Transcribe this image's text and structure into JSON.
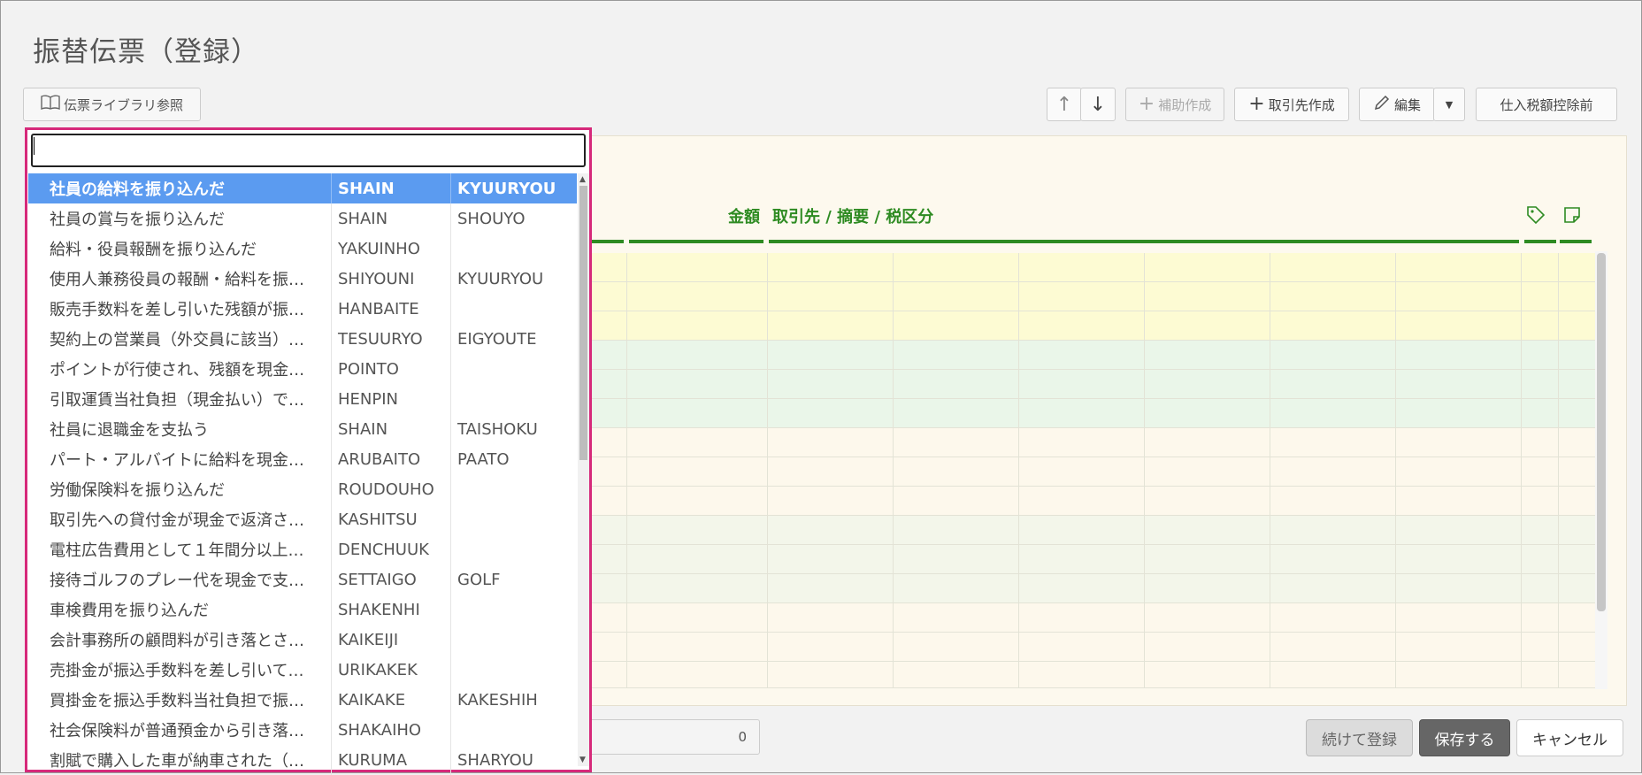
{
  "page": {
    "title": "振替伝票（登録）"
  },
  "toolbar": {
    "library_label": "伝票ライブラリ参照",
    "up_label": "↑",
    "down_label": "↓",
    "sub_create_label": "補助作成",
    "partner_create_label": "取引先作成",
    "edit_label": "編集",
    "tax_label": "仕入税額控除前"
  },
  "grid": {
    "amount_header": "金額",
    "partner_header": "取引先 / 摘要 / 税区分"
  },
  "footer": {
    "total_value": "0",
    "continue_label": "続けて登録",
    "save_label": "保存する",
    "cancel_label": "キャンセル"
  },
  "dropdown": {
    "search_value": "",
    "items": [
      {
        "name": "社員の給料を振り込んだ",
        "code1": "SHAIN",
        "code2": "KYUURYOU"
      },
      {
        "name": "社員の賞与を振り込んだ",
        "code1": "SHAIN",
        "code2": "SHOUYO"
      },
      {
        "name": "給料・役員報酬を振り込んだ",
        "code1": "YAKUINHO",
        "code2": ""
      },
      {
        "name": "使用人兼務役員の報酬・給料を振…",
        "code1": "SHIYOUNI",
        "code2": "KYUURYOU"
      },
      {
        "name": "販売手数料を差し引いた残額が振…",
        "code1": "HANBAITE",
        "code2": ""
      },
      {
        "name": "契約上の営業員（外交員に該当）…",
        "code1": "TESUURYO",
        "code2": "EIGYOUTE"
      },
      {
        "name": "ポイントが行使され、残額を現金…",
        "code1": "POINTO",
        "code2": ""
      },
      {
        "name": "引取運賃当社負担（現金払い）で…",
        "code1": "HENPIN",
        "code2": ""
      },
      {
        "name": "社員に退職金を支払う",
        "code1": "SHAIN",
        "code2": "TAISHOKU"
      },
      {
        "name": "パート・アルバイトに給料を現金…",
        "code1": "ARUBAITO",
        "code2": "PAATO"
      },
      {
        "name": "労働保険料を振り込んだ",
        "code1": "ROUDOUHO",
        "code2": ""
      },
      {
        "name": "取引先への貸付金が現金で返済さ…",
        "code1": "KASHITSU",
        "code2": ""
      },
      {
        "name": "電柱広告費用として１年間分以上…",
        "code1": "DENCHUUK",
        "code2": ""
      },
      {
        "name": "接待ゴルフのプレー代を現金で支…",
        "code1": "SETTAIGO",
        "code2": "GOLF"
      },
      {
        "name": "車検費用を振り込んだ",
        "code1": "SHAKENHI",
        "code2": ""
      },
      {
        "name": "会計事務所の顧問料が引き落とさ…",
        "code1": "KAIKEIJI",
        "code2": ""
      },
      {
        "name": "売掛金が振込手数料を差し引いて…",
        "code1": "URIKAKEK",
        "code2": ""
      },
      {
        "name": "買掛金を振込手数料当社負担で振…",
        "code1": "KAIKAKE",
        "code2": "KAKESHIH"
      },
      {
        "name": "社会保険料が普通預金から引き落…",
        "code1": "SHAKAIHO",
        "code2": ""
      },
      {
        "name": "割賦で購入した車が納車された（…",
        "code1": "KURUMA",
        "code2": "SHARYOU"
      }
    ]
  }
}
